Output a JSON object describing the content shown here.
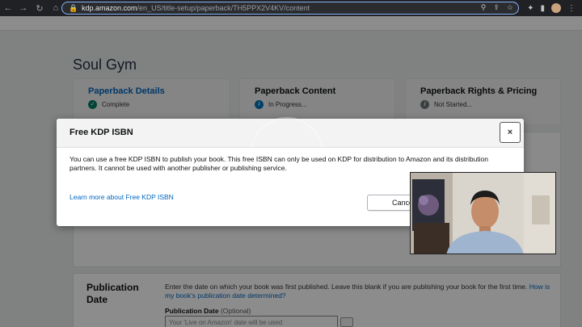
{
  "browser": {
    "url_host": "kdp.amazon.com",
    "url_path": "/en_US/title-setup/paperback/TH5PPX2V4KV/content"
  },
  "page": {
    "book_title": "Soul Gym",
    "steps": [
      {
        "name": "Paperback Details",
        "status": "Complete"
      },
      {
        "name": "Paperback Content",
        "status": "In Progress..."
      },
      {
        "name": "Paperback Rights & Pricing",
        "status": "Not Started..."
      }
    ],
    "publication_date": {
      "label": "Publication Date",
      "description": "Enter the date on which your book was first published. Leave this blank if you are publishing your book for the first time.",
      "help_link": "How is my book's publication date determined?",
      "field_label": "Publication Date",
      "field_optional": "(Optional)",
      "field_placeholder": "Your 'Live on Amazon' date will be used"
    }
  },
  "modal": {
    "title": "Free KDP ISBN",
    "close_label": "×",
    "body": "You can use a free KDP ISBN to publish your book. This free ISBN can only be used on KDP for distribution to Amazon and its distribution partners. It cannot be used with another publisher or publishing service.",
    "learn_more": "Learn more about Free KDP ISBN",
    "cancel_label": "Cancel"
  },
  "icons": {
    "back": "back-arrow-icon",
    "forward": "forward-arrow-icon",
    "reload": "reload-icon",
    "home": "home-icon",
    "lock": "lock-icon",
    "complete": "check-circle-icon",
    "info": "info-icon"
  },
  "colors": {
    "link": "#0066c0",
    "complete": "#067d62",
    "info": "#0073bb",
    "chrome": "#202124"
  }
}
